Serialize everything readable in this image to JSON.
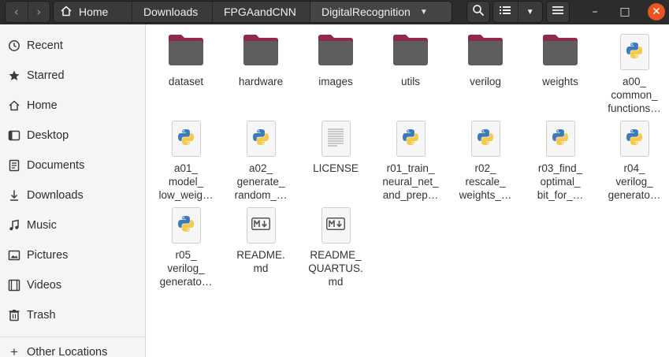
{
  "headerbar": {
    "breadcrumbs": [
      {
        "label": "Home"
      },
      {
        "label": "Downloads"
      },
      {
        "label": "FPGAandCNN"
      },
      {
        "label": "DigitalRecognition"
      }
    ],
    "window_controls": {
      "minimize": "–",
      "maximize": "□",
      "close": "✕"
    }
  },
  "sidebar": {
    "items": [
      {
        "label": "Recent",
        "icon": "clock-icon"
      },
      {
        "label": "Starred",
        "icon": "star-icon"
      },
      {
        "label": "Home",
        "icon": "home-icon"
      },
      {
        "label": "Desktop",
        "icon": "desktop-icon"
      },
      {
        "label": "Documents",
        "icon": "document-icon"
      },
      {
        "label": "Downloads",
        "icon": "download-icon"
      },
      {
        "label": "Music",
        "icon": "music-icon"
      },
      {
        "label": "Pictures",
        "icon": "picture-icon"
      },
      {
        "label": "Videos",
        "icon": "video-icon"
      },
      {
        "label": "Trash",
        "icon": "trash-icon"
      },
      {
        "label": "Other Locations",
        "icon": "plus-icon"
      }
    ]
  },
  "files": [
    {
      "name": "dataset",
      "type": "folder"
    },
    {
      "name": "hardware",
      "type": "folder"
    },
    {
      "name": "images",
      "type": "folder"
    },
    {
      "name": "utils",
      "type": "folder"
    },
    {
      "name": "verilog",
      "type": "folder"
    },
    {
      "name": "weights",
      "type": "folder"
    },
    {
      "name": "a00_\ncommon_\nfunctions…",
      "type": "python"
    },
    {
      "name": "a01_\nmodel_\nlow_weig…",
      "type": "python"
    },
    {
      "name": "a02_\ngenerate_\nrandom_…",
      "type": "python"
    },
    {
      "name": "LICENSE",
      "type": "text"
    },
    {
      "name": "r01_train_\nneural_net_\nand_prep…",
      "type": "python"
    },
    {
      "name": "r02_\nrescale_\nweights_…",
      "type": "python"
    },
    {
      "name": "r03_find_\noptimal_\nbit_for_…",
      "type": "python"
    },
    {
      "name": "r04_\nverilog_\ngenerato…",
      "type": "python"
    },
    {
      "name": "r05_\nverilog_\ngenerato…",
      "type": "python"
    },
    {
      "name": "README.\nmd",
      "type": "markdown"
    },
    {
      "name": "README_\nQUARTUS.\nmd",
      "type": "markdown"
    }
  ],
  "colors": {
    "folder_body": "#5e5e5e",
    "folder_tab": "#8e2a4a",
    "accent": "#e95420",
    "python_blue": "#3d7ab8",
    "python_yellow": "#f7c948"
  }
}
